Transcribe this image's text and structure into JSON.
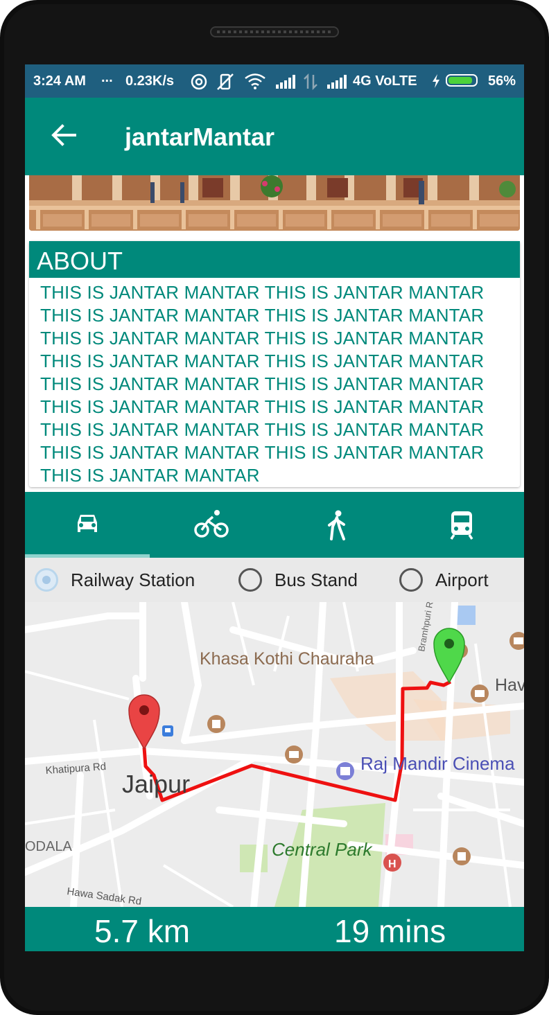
{
  "status_bar": {
    "time": "3:24 AM",
    "dots": "...",
    "speed": "0.23K/s",
    "network": "4G VoLTE",
    "battery_percent": "56%",
    "battery_level": 0.9
  },
  "app_bar": {
    "title": "jantarMantar"
  },
  "about": {
    "heading": "ABOUT",
    "lines": [
      "THIS IS JANTAR MANTAR THIS IS JANTAR MANTAR",
      "THIS IS JANTAR MANTAR THIS IS JANTAR MANTAR",
      "THIS IS JANTAR MANTAR THIS IS JANTAR MANTAR",
      "THIS IS JANTAR MANTAR THIS IS JANTAR MANTAR",
      "THIS IS JANTAR MANTAR THIS IS JANTAR MANTAR",
      "THIS IS JANTAR MANTAR THIS IS JANTAR MANTAR",
      "THIS IS JANTAR MANTAR THIS IS JANTAR MANTAR",
      "THIS IS JANTAR MANTAR THIS IS JANTAR MANTAR",
      "THIS IS JANTAR MANTAR"
    ]
  },
  "travel_modes": [
    {
      "icon": "car-icon",
      "selected": true
    },
    {
      "icon": "bicycle-icon",
      "selected": false
    },
    {
      "icon": "walk-icon",
      "selected": false
    },
    {
      "icon": "train-icon",
      "selected": false
    }
  ],
  "destinations": [
    {
      "label": "Railway Station",
      "selected": true
    },
    {
      "label": "Bus Stand",
      "selected": false
    },
    {
      "label": "Airport",
      "selected": false
    }
  ],
  "map": {
    "labels": {
      "khasa_kothi": "Khasa Kothi Chauraha",
      "jaipur": "Jaipur",
      "raj_mandir": "Raj Mandir Cinema",
      "central_park": "Central Park",
      "khatipura": "Khatipura Rd",
      "hawa_sadak": "Hawa Sadak Rd",
      "odala": "ODALA",
      "brahmpuri": "Bramhpuri Rd",
      "hav": "Hav"
    },
    "route_color": "#ee1111"
  },
  "summary": {
    "distance": "5.7 km",
    "duration": "19 mins"
  },
  "colors": {
    "primary": "#00897b",
    "status_bar": "#1f5f7f"
  }
}
